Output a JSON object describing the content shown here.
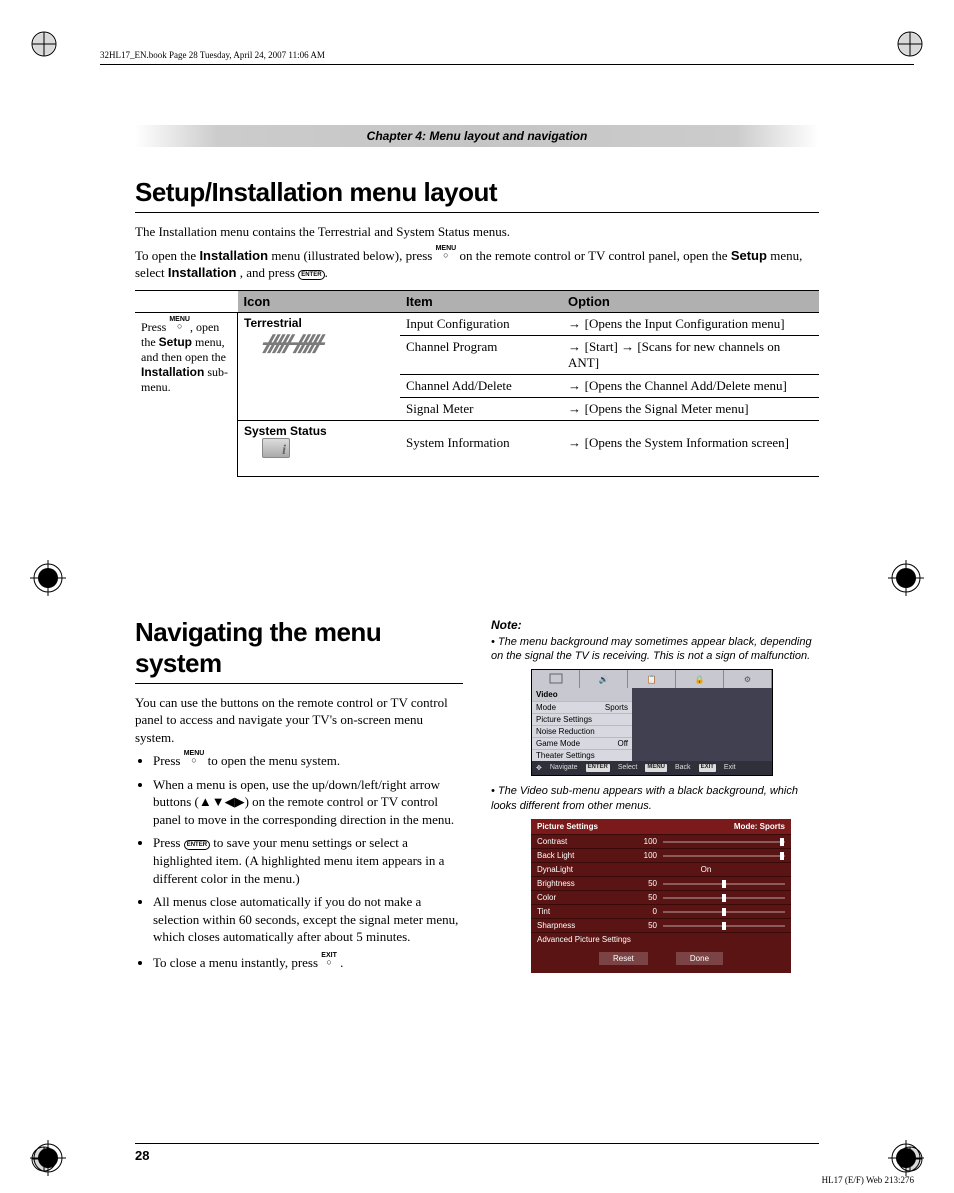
{
  "header_line": "32HL17_EN.book  Page 28  Tuesday, April 24, 2007  11:06 AM",
  "chapter_bar": "Chapter 4: Menu layout and navigation",
  "section1_title": "Setup/Installation menu layout",
  "section1_p1": "The Installation menu contains the Terrestrial and System Status menus.",
  "section1_p2a": "To open the ",
  "section1_p2b": "Installation",
  "section1_p2c": " menu (illustrated below), press ",
  "section1_p2d": " on the remote control or TV control panel, open the ",
  "section1_p2e": "Setup",
  "section1_p2f": " menu, select ",
  "section1_p2g": "Installation",
  "section1_p2h": ", and press ",
  "menu_label": "MENU",
  "exit_label": "EXIT",
  "enter_label": "ENTER",
  "navcol": {
    "l1": "Press ",
    "l2": ", open the ",
    "l3": "Setup",
    "l4": " menu, and then open the ",
    "l5": "Installation",
    "l6": " sub-menu."
  },
  "th": {
    "icon": "Icon",
    "item": "Item",
    "option": "Option"
  },
  "rows": [
    {
      "icon": "Terrestrial",
      "item": "Input Configuration",
      "opt": "[Opens the Input Configuration menu]"
    },
    {
      "item": "Channel Program",
      "opt": "[Start] → [Scans for new channels on ANT]"
    },
    {
      "item": "Channel Add/Delete",
      "opt": "[Opens the Channel Add/Delete menu]"
    },
    {
      "item": "Signal Meter",
      "opt": "[Opens the Signal Meter menu]"
    },
    {
      "icon": "System Status",
      "item": "System Information",
      "opt": "[Opens the System Information screen]"
    }
  ],
  "section2_title": "Navigating the menu system",
  "section2_p1": "You can use the buttons on the remote control or TV control panel to access and navigate your TV's on-screen menu system.",
  "bullets": {
    "b1a": "Press ",
    "b1b": " to open the menu system.",
    "b2": "When a menu is open, use the up/down/left/right arrow buttons (▲▼◀▶) on the remote control or TV control panel to move in the corresponding direction in the menu.",
    "b3a": "Press ",
    "b3b": " to save your menu settings or select a highlighted item. (A highlighted menu item appears in a different color in the menu.)",
    "b4": "All menus close automatically if you do not make a selection within 60 seconds, except the signal meter menu, which closes automatically after about 5 minutes.",
    "b5a": "To close a menu instantly, press ",
    "b5b": "."
  },
  "note_head": "Note:",
  "note1": "The menu background may sometimes appear black, depending on the signal the TV is receiving. This is not a sign of malfunction.",
  "note2": "The Video sub-menu appears with a black background, which looks different from other menus.",
  "osd1": {
    "title": "Video",
    "rows": [
      {
        "label": "Mode",
        "val": "Sports"
      },
      {
        "label": "Picture Settings",
        "val": ""
      },
      {
        "label": "Noise Reduction",
        "val": ""
      },
      {
        "label": "Game Mode",
        "val": "Off"
      },
      {
        "label": "Theater Settings",
        "val": ""
      }
    ],
    "footer": {
      "nav": "Navigate",
      "sel": "Select",
      "back": "Back",
      "exit": "Exit",
      "sel_btn": "ENTER",
      "back_btn": "MENU",
      "exit_btn": "EXIT"
    }
  },
  "osd2": {
    "title": "Picture Settings",
    "mode": "Mode: Sports",
    "rows": [
      {
        "label": "Contrast",
        "val": "100",
        "pos": 100
      },
      {
        "label": "Back Light",
        "val": "100",
        "pos": 100
      },
      {
        "label": "DynaLight",
        "center": "On"
      },
      {
        "label": "Brightness",
        "val": "50",
        "pos": 50
      },
      {
        "label": "Color",
        "val": "50",
        "pos": 50
      },
      {
        "label": "Tint",
        "val": "0",
        "pos": 50
      },
      {
        "label": "Sharpness",
        "val": "50",
        "pos": 50
      }
    ],
    "adv": "Advanced Picture Settings",
    "reset": "Reset",
    "done": "Done"
  },
  "page_number": "28",
  "footer_code": "HL17 (E/F) Web 213:276"
}
